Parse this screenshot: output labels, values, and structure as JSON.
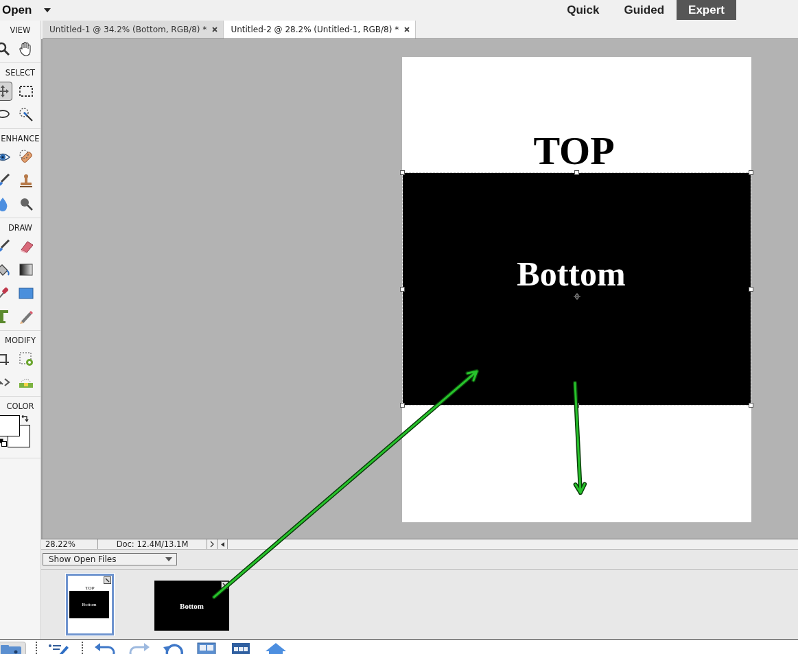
{
  "menu": {
    "label": "Open"
  },
  "modes": [
    {
      "label": "Quick",
      "selected": false
    },
    {
      "label": "Guided",
      "selected": false
    },
    {
      "label": "Expert",
      "selected": true
    }
  ],
  "toolbar": {
    "sections": [
      {
        "label": "VIEW",
        "tools": [
          {
            "kind": "zoom",
            "selected": false
          },
          {
            "kind": "hand",
            "selected": false
          }
        ]
      },
      {
        "label": "SELECT",
        "tools": [
          {
            "kind": "move",
            "selected": true
          },
          {
            "kind": "marquee",
            "selected": false
          },
          {
            "kind": "lasso",
            "selected": false
          },
          {
            "kind": "wand",
            "selected": false
          }
        ]
      },
      {
        "label": "ENHANCE",
        "tools": [
          {
            "kind": "eye",
            "selected": false
          },
          {
            "kind": "bandage",
            "selected": false
          },
          {
            "kind": "brush",
            "selected": false
          },
          {
            "kind": "stamp",
            "selected": false
          },
          {
            "kind": "drop",
            "selected": false
          },
          {
            "kind": "smudge",
            "selected": false
          }
        ]
      },
      {
        "label": "DRAW",
        "tools": [
          {
            "kind": "brush",
            "selected": false
          },
          {
            "kind": "eraser",
            "selected": false
          },
          {
            "kind": "bucket",
            "selected": false
          },
          {
            "kind": "gradient",
            "selected": false
          },
          {
            "kind": "dropper",
            "selected": false
          },
          {
            "kind": "shape",
            "selected": false
          },
          {
            "kind": "type",
            "selected": false
          },
          {
            "kind": "pencil",
            "selected": false
          }
        ]
      },
      {
        "label": "MODIFY",
        "tools": [
          {
            "kind": "crop",
            "selected": false
          },
          {
            "kind": "recompose",
            "selected": false
          },
          {
            "kind": "straighten",
            "selected": false
          },
          {
            "kind": "level",
            "selected": false
          }
        ]
      },
      {
        "label": "COLOR"
      }
    ]
  },
  "document_tabs": [
    {
      "title": "Untitled-1 @ 34.2% (Bottom, RGB/8) *",
      "selected": false
    },
    {
      "title": "Untitled-2 @ 28.2% (Untitled-1, RGB/8) *",
      "selected": true
    }
  ],
  "canvas": {
    "top_text": "TOP",
    "layer_text": "Bottom"
  },
  "status_bar": {
    "zoom": "28.22%",
    "doc_size": "Doc: 12.4M/13.1M"
  },
  "project_bin": {
    "filter": "Show Open Files",
    "thumbnails": [
      {
        "kind": "portrait",
        "top_text": "TOP",
        "layer_text": "Bottom",
        "selected": true
      },
      {
        "kind": "landscape",
        "layer_text": "Bottom",
        "selected": false
      }
    ]
  },
  "annotations": [
    {
      "kind": "arrow"
    },
    {
      "kind": "arrow"
    }
  ]
}
